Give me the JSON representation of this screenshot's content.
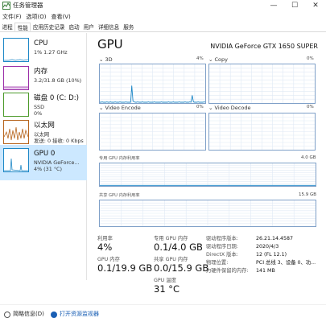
{
  "window": {
    "title": "任务管理器",
    "minimize_glyph": "—",
    "maximize_glyph": "☐",
    "close_glyph": "✕"
  },
  "menu": [
    "文件(F)",
    "选项(O)",
    "查看(V)"
  ],
  "tabs": [
    "进程",
    "性能",
    "应用历史记录",
    "启动",
    "用户",
    "详细信息",
    "服务"
  ],
  "active_tab": "性能",
  "sidebar": [
    {
      "name": "CPU",
      "sub1": "1% 1.27 GHz",
      "sub2": "",
      "color": "#1e88c7"
    },
    {
      "name": "内存",
      "sub1": "3.2/31.8 GB (10%)",
      "sub2": "",
      "color": "#9b2ea8"
    },
    {
      "name": "磁盘 0 (C: D:)",
      "sub1": "SSD",
      "sub2": "0%",
      "color": "#4c9a2a"
    },
    {
      "name": "以太网",
      "sub1": "以太网",
      "sub2": "发送: 0 接收: 0 Kbps",
      "color": "#b7651e"
    },
    {
      "name": "GPU 0",
      "sub1": "NVIDIA GeForce...",
      "sub2": "4% (31 °C)",
      "color": "#1e88c7"
    }
  ],
  "gpu": {
    "title": "GPU",
    "model": "NVIDIA GeForce GTX 1650 SUPER",
    "engines": [
      {
        "name": "3D",
        "percent": "4%"
      },
      {
        "name": "Copy",
        "percent": "0%"
      },
      {
        "name": "Video Encode",
        "percent": "0%"
      },
      {
        "name": "Video Decode",
        "percent": "0%"
      }
    ],
    "dedicated_label": "专用 GPU 内存利用率",
    "dedicated_max": "4.0 GB",
    "shared_label": "共享 GPU 内存利用率",
    "shared_max": "15.9 GB",
    "utilization_3d": [
      2,
      2,
      3,
      2,
      2,
      2,
      3,
      2,
      2,
      3,
      2,
      2,
      2,
      3,
      2,
      2,
      2,
      3,
      2,
      2,
      2,
      2,
      3,
      2,
      2,
      2,
      2,
      45,
      5,
      3,
      2,
      2,
      3,
      2,
      2,
      2,
      3,
      2,
      2,
      2,
      2,
      3,
      2,
      2,
      2,
      2,
      3,
      2,
      2,
      2,
      2,
      2,
      3,
      2,
      2,
      2,
      2,
      2,
      3,
      2,
      2,
      2,
      3,
      2,
      2,
      2,
      2,
      3,
      2,
      2,
      2,
      2,
      3,
      2,
      2,
      2,
      3,
      2,
      20,
      3,
      2,
      2,
      2,
      3,
      2,
      2,
      2,
      2,
      3,
      2
    ],
    "dedicated_usage_fraction": 0.025,
    "shared_usage_fraction": 0.0
  },
  "stats": {
    "utilization_label": "利用率",
    "utilization_value": "4%",
    "dedicated_mem_label": "专用 GPU 内存",
    "dedicated_mem_value": "0.1/4.0 GB",
    "gpu_mem_label": "GPU 内存",
    "gpu_mem_value": "0.1/19.9 GB",
    "shared_mem_label": "共享 GPU 内存",
    "shared_mem_value": "0.0/15.9 GB",
    "temp_label": "GPU 温度",
    "temp_value": "31 °C"
  },
  "info": [
    {
      "key": "驱动程序版本:",
      "value": "26.21.14.4587"
    },
    {
      "key": "驱动程序日期:",
      "value": "2020/4/3"
    },
    {
      "key": "DirectX 版本:",
      "value": "12 (FL 12.1)"
    },
    {
      "key": "物理位置:",
      "value": "PCI 总线 3、设备 0、功..."
    },
    {
      "key": "为硬件保留的内存:",
      "value": "141 MB"
    }
  ],
  "footer": {
    "brief": "简略信息(D)",
    "open_monitor": "打开资源监视器"
  },
  "colors": {
    "accent": "#1e88c7",
    "graph_border": "#7fa0c8",
    "grid": "#dfe9f5",
    "selected_bg": "#cce8ff"
  }
}
